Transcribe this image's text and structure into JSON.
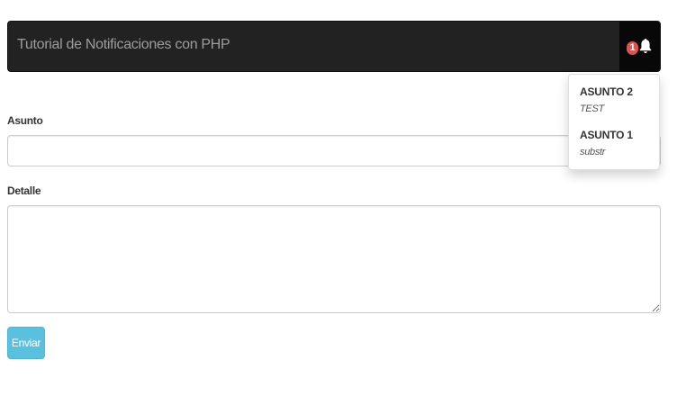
{
  "navbar": {
    "brand": "Tutorial de Notificaciones con PHP",
    "notification_count": "1",
    "icon": "bell-icon"
  },
  "notifications": [
    {
      "subject": "ASUNTO 2",
      "detail": "TEST"
    },
    {
      "subject": "ASUNTO 1",
      "detail": "substr"
    }
  ],
  "form": {
    "subject_label": "Asunto",
    "subject_value": "",
    "detail_label": "Detalle",
    "detail_value": "",
    "submit_label": "Enviar"
  },
  "colors": {
    "navbar_bg": "#222222",
    "badge": "#d9534f",
    "button": "#5bc0de"
  }
}
